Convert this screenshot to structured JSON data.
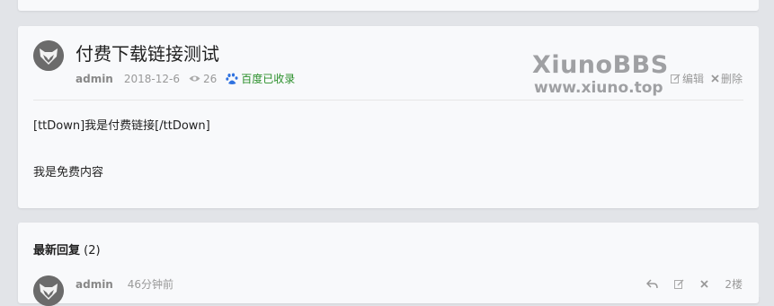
{
  "post": {
    "title": "付费下载链接测试",
    "author": "admin",
    "date": "2018-12-6",
    "views": "26",
    "baidu_label": "百度已收录",
    "edit_label": "编辑",
    "delete_label": "删除",
    "content_lines": [
      "[ttDown]我是付费链接[/ttDown]",
      "我是免费内容"
    ]
  },
  "watermark": {
    "title": "XiunoBBS",
    "url": "www.xiuno.top"
  },
  "replies": {
    "heading": "最新回复",
    "count": "(2)",
    "items": [
      {
        "author": "admin",
        "time": "46分钟前",
        "floor": "2楼"
      }
    ]
  },
  "icons": {
    "views": "eye-icon",
    "baidu": "baidu-paw-icon",
    "edit": "edit-icon",
    "delete": "close-icon",
    "reply": "reply-icon"
  },
  "colors": {
    "baidu_green": "#2a8f2a",
    "baidu_blue": "#2f72e0",
    "meta_gray": "#999999"
  }
}
